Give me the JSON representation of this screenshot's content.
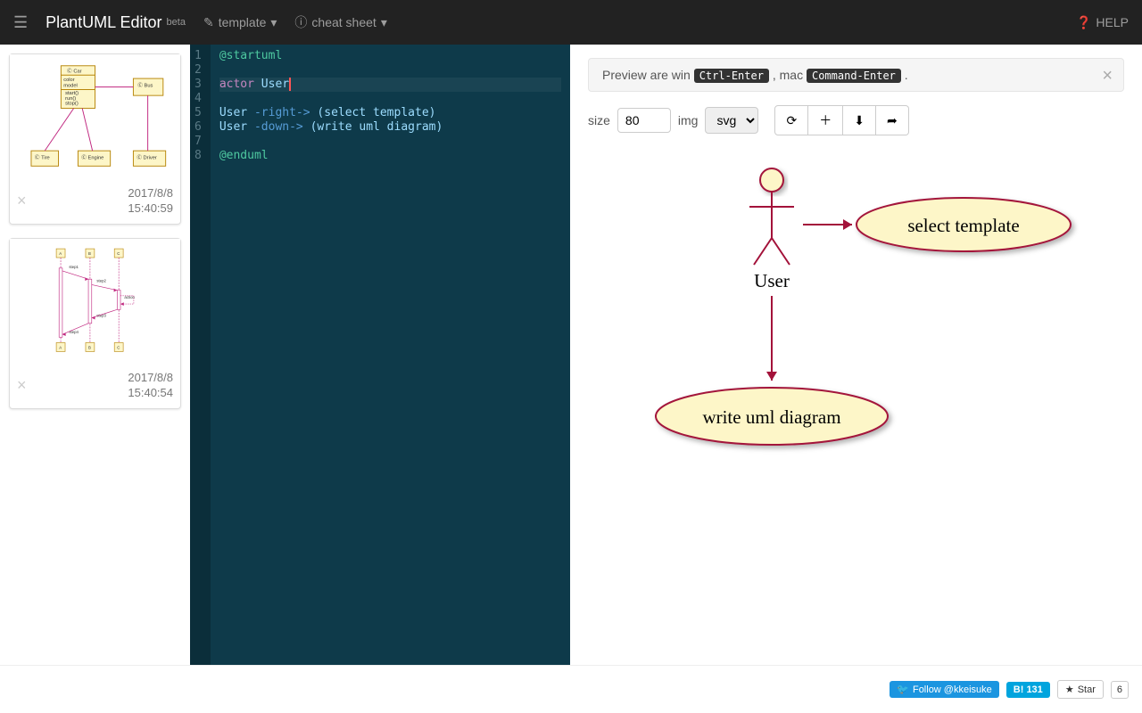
{
  "navbar": {
    "title": "PlantUML Editor",
    "beta": "beta",
    "template_label": "template",
    "cheatsheet_label": "cheat sheet",
    "help_label": "HELP"
  },
  "history": [
    {
      "date": "2017/8/8",
      "time": "15:40:59"
    },
    {
      "date": "2017/8/8",
      "time": "15:40:54"
    }
  ],
  "editor": {
    "lines": [
      {
        "n": 1,
        "segs": [
          [
            "at",
            "@startuml"
          ]
        ]
      },
      {
        "n": 2,
        "segs": []
      },
      {
        "n": 3,
        "segs": [
          [
            "key",
            "actor"
          ],
          [
            "txt",
            " User"
          ]
        ],
        "active": true,
        "cursor": true
      },
      {
        "n": 4,
        "segs": []
      },
      {
        "n": 5,
        "segs": [
          [
            "txt",
            "User "
          ],
          [
            "arrow",
            "-right->"
          ],
          [
            "txt",
            " (select template)"
          ]
        ]
      },
      {
        "n": 6,
        "segs": [
          [
            "txt",
            "User "
          ],
          [
            "arrow",
            "-down->"
          ],
          [
            "txt",
            " (write uml diagram)"
          ]
        ]
      },
      {
        "n": 7,
        "segs": []
      },
      {
        "n": 8,
        "segs": [
          [
            "at",
            "@enduml"
          ]
        ]
      }
    ]
  },
  "alert": {
    "prefix": "Preview are win ",
    "kbd1": "Ctrl-Enter",
    "mid": ", mac ",
    "kbd2": "Command-Enter",
    "suffix": " ."
  },
  "toolbar": {
    "size_label": "size",
    "size_value": "80",
    "img_label": "img",
    "img_value": "svg"
  },
  "diagram": {
    "actor_label": "User",
    "usecase1": "select template",
    "usecase2": "write uml diagram"
  },
  "footer": {
    "twitter": "Follow @kkeisuke",
    "hatena": "B! 131",
    "star": "Star",
    "star_count": "6"
  },
  "thumb1": {
    "classes": [
      "Car",
      "Bus",
      "Tire",
      "Engine",
      "Driver"
    ],
    "attrs": [
      "color",
      "model"
    ],
    "methods": [
      "start()",
      "run()",
      "stop()"
    ]
  },
  "thumb2": {
    "participants": [
      "A",
      "B",
      "C"
    ],
    "steps": [
      "step1",
      "step2",
      "action",
      "step3",
      "step4"
    ]
  }
}
